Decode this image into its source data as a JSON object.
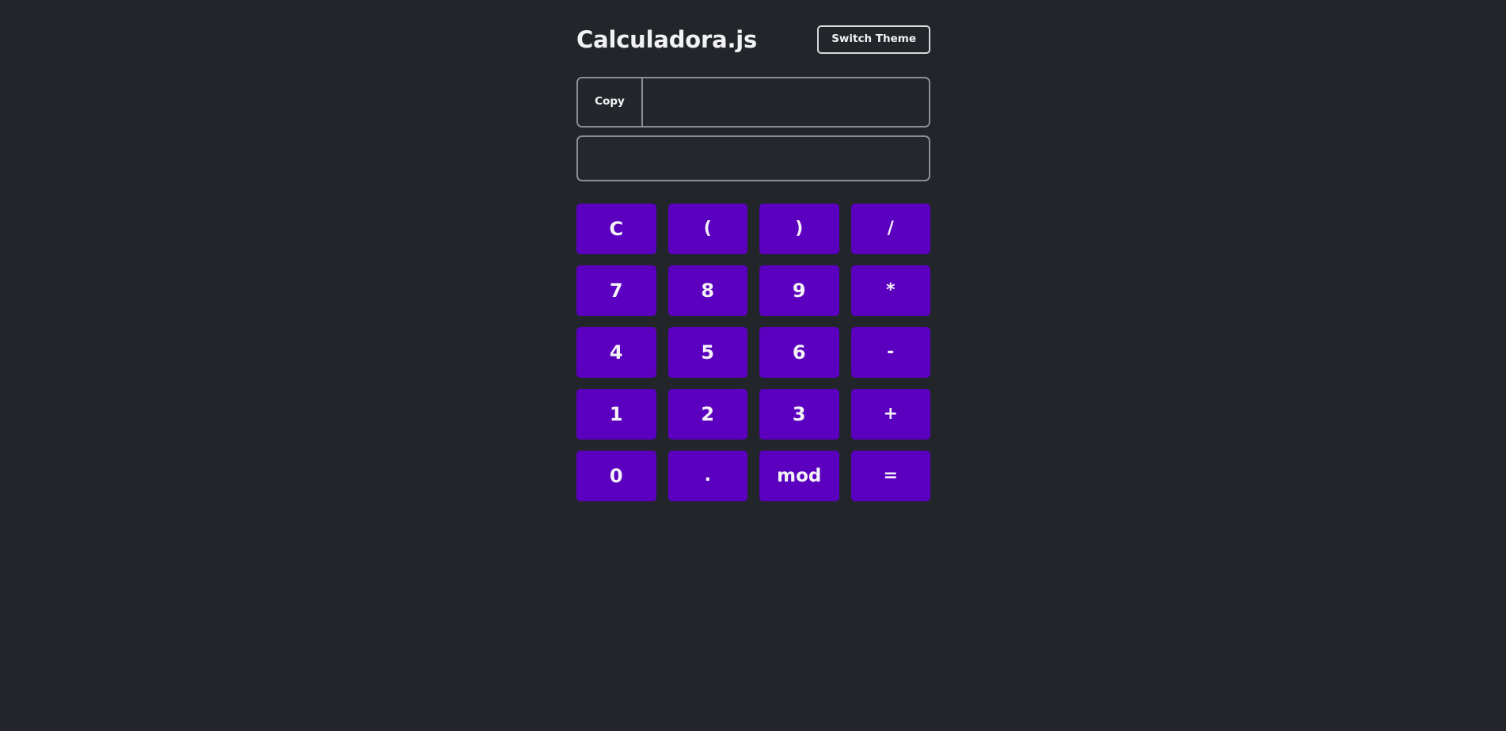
{
  "theme": {
    "background": "#22262b",
    "key_color": "#5b00bf",
    "key_text": "#f4f2f7",
    "border": "#8b8f94",
    "text": "#f2f2f4"
  },
  "header": {
    "title": "Calculadora.js",
    "switch_theme_label": "Switch Theme"
  },
  "expression": {
    "copy_label": "Copy",
    "value": "",
    "placeholder": ""
  },
  "result": {
    "value": "",
    "placeholder": ""
  },
  "keypad": {
    "keys": [
      {
        "label": "C",
        "kind": "clear"
      },
      {
        "label": "(",
        "kind": "op"
      },
      {
        "label": ")",
        "kind": "op"
      },
      {
        "label": "/",
        "kind": "op"
      },
      {
        "label": "7",
        "kind": "digit"
      },
      {
        "label": "8",
        "kind": "digit"
      },
      {
        "label": "9",
        "kind": "digit"
      },
      {
        "label": "*",
        "kind": "op"
      },
      {
        "label": "4",
        "kind": "digit"
      },
      {
        "label": "5",
        "kind": "digit"
      },
      {
        "label": "6",
        "kind": "digit"
      },
      {
        "label": "-",
        "kind": "op"
      },
      {
        "label": "1",
        "kind": "digit"
      },
      {
        "label": "2",
        "kind": "digit"
      },
      {
        "label": "3",
        "kind": "digit"
      },
      {
        "label": "+",
        "kind": "op"
      },
      {
        "label": "0",
        "kind": "digit"
      },
      {
        "label": ".",
        "kind": "op"
      },
      {
        "label": "mod",
        "kind": "word"
      },
      {
        "label": "=",
        "kind": "op"
      }
    ]
  }
}
